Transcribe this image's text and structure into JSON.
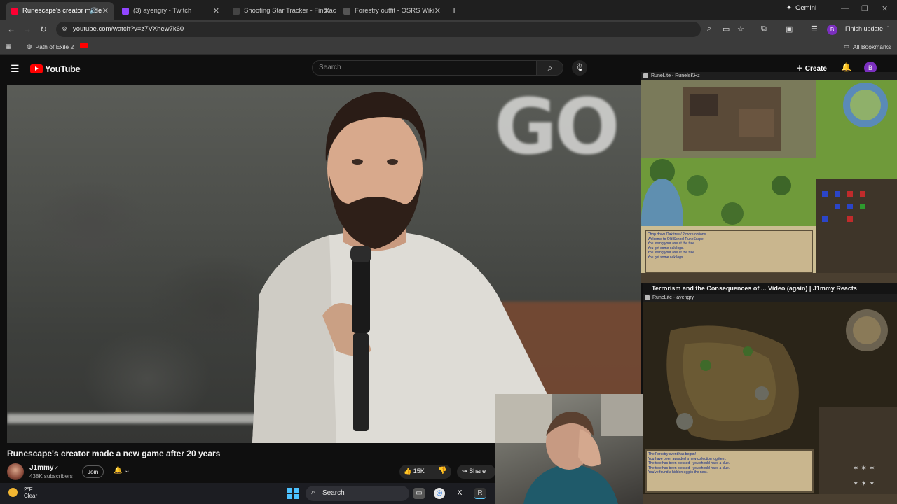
{
  "browser": {
    "tabs": [
      {
        "title": "Runescape's creator made",
        "favicon_color": "#ff0033",
        "active": true
      },
      {
        "title": "(3) ayengry - Twitch",
        "favicon_color": "#9146ff",
        "active": false
      },
      {
        "title": "Shooting Star Tracker - Find ac",
        "favicon_color": "#2a2a2a",
        "active": false
      },
      {
        "title": "Forestry outfit - OSRS Wiki",
        "favicon_color": "#3a3a3a",
        "active": false
      }
    ],
    "new_tab_icon": "plus-icon",
    "gemini_label": "Gemini",
    "url": "youtube.com/watch?v=z7VXhew7k60",
    "finish_update_label": "Finish update",
    "profile_initial": "B",
    "bookmarks": [
      {
        "label": "Path of Exile 2",
        "icon": "globe-icon"
      }
    ],
    "all_bookmarks_label": "All Bookmarks"
  },
  "youtube": {
    "logo_text": "YouTube",
    "search_placeholder": "Search",
    "create_label": "Create",
    "avatar_initial": "B",
    "video": {
      "title": "Runescape's creator made a new game after 20 years",
      "channel_name": "J1mmy",
      "subscribers": "438K subscribers",
      "join_label": "Join",
      "likes": "15K",
      "share_label": "Share"
    }
  },
  "runelite": {
    "window1_title": "RuneLite - RuneIsKHz",
    "window1_chat_lines": [
      "Chop down Oak tree / 2 more options",
      "Welcome to Old School RuneScape.",
      "You swing your axe at the tree.",
      "You get some oak logs.",
      "You swing your axe at the tree.",
      "You get some oak logs."
    ],
    "window2_title": "RuneLite - ayengry",
    "window2_chat_lines": [
      "The Forestry event has begun!",
      "You have been awarded a new collection log item.",
      "The tree has been blessed - you should have a clue.",
      "The tree has been blessed - you should have a clue.",
      "You've found a hidden egg in the nest."
    ],
    "caption_left": "Terrorism and the Consequences of ...",
    "caption_right": "Video (again) | J1mmy Reacts"
  },
  "taskbar": {
    "temperature": "2°F",
    "condition": "Clear",
    "search_label": "Search"
  }
}
